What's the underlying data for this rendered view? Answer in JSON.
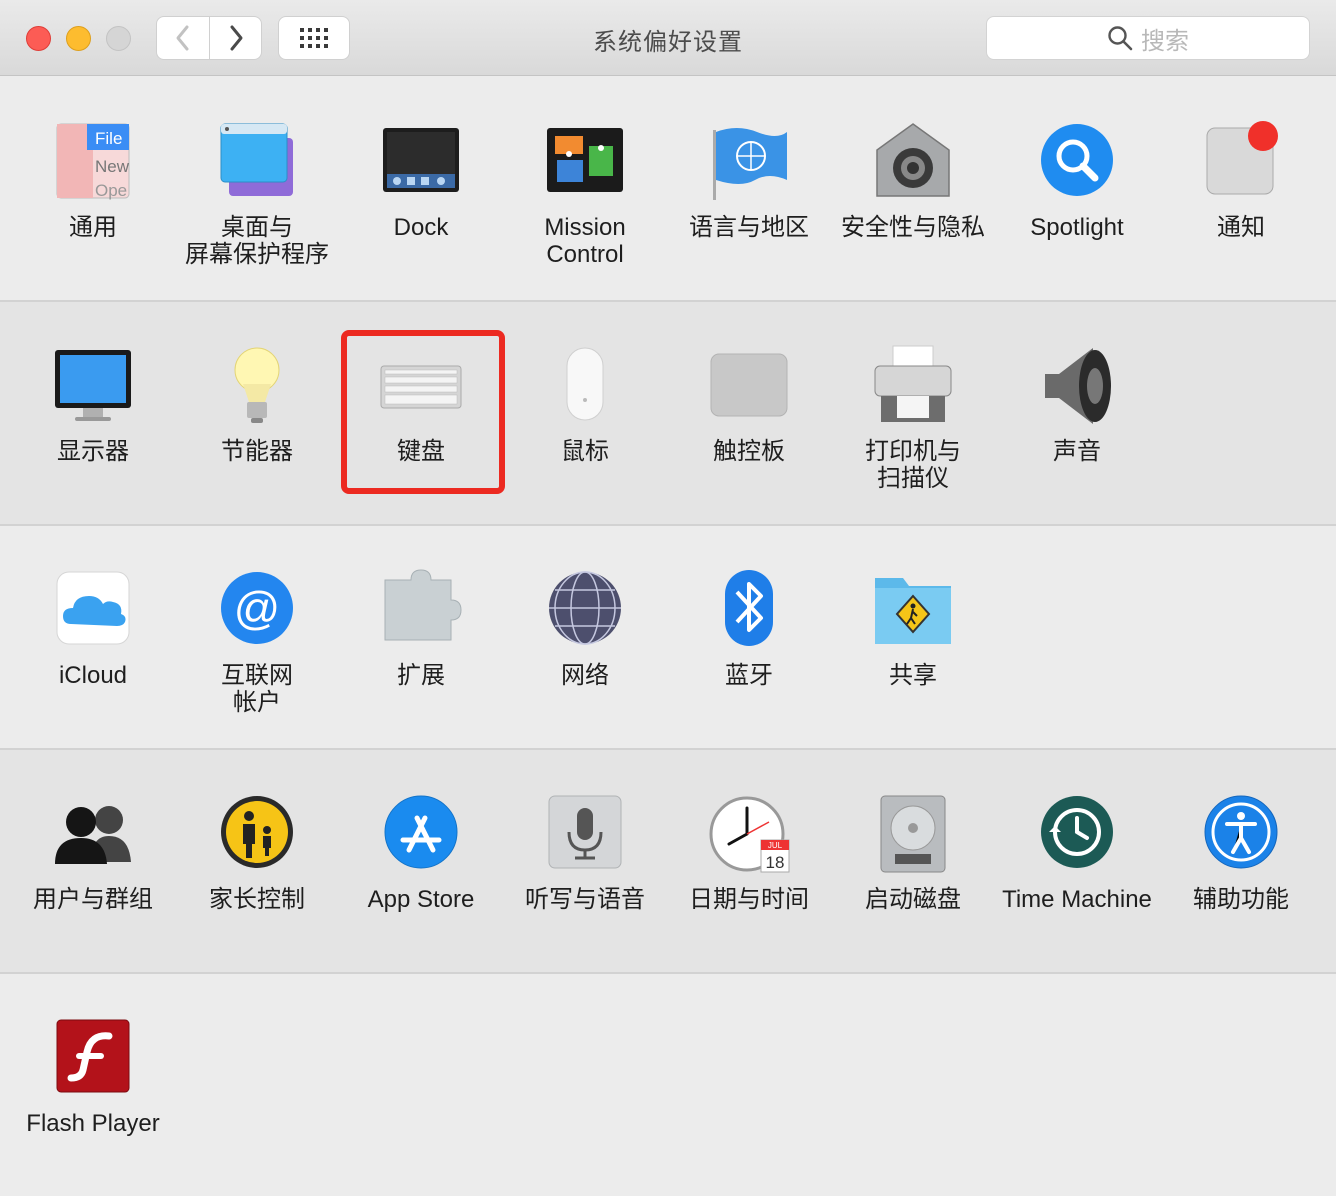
{
  "window": {
    "title": "系统偏好设置",
    "search_placeholder": "搜索"
  },
  "rows": [
    [
      {
        "icon": "general-icon",
        "label": "通用",
        "icon_text": [
          "File",
          "New",
          "Ope"
        ]
      },
      {
        "icon": "desktop-screensaver-icon",
        "label": "桌面与\n屏幕保护程序"
      },
      {
        "icon": "dock-icon",
        "label": "Dock"
      },
      {
        "icon": "mission-control-icon",
        "label": "Mission\nControl"
      },
      {
        "icon": "language-region-icon",
        "label": "语言与地区"
      },
      {
        "icon": "security-privacy-icon",
        "label": "安全性与隐私"
      },
      {
        "icon": "spotlight-icon",
        "label": "Spotlight"
      },
      {
        "icon": "notifications-icon",
        "label": "通知"
      }
    ],
    [
      {
        "icon": "displays-icon",
        "label": "显示器"
      },
      {
        "icon": "energy-saver-icon",
        "label": "节能器"
      },
      {
        "icon": "keyboard-icon",
        "label": "键盘"
      },
      {
        "icon": "mouse-icon",
        "label": "鼠标"
      },
      {
        "icon": "trackpad-icon",
        "label": "触控板"
      },
      {
        "icon": "printers-scanners-icon",
        "label": "打印机与\n扫描仪"
      },
      {
        "icon": "sound-icon",
        "label": "声音"
      }
    ],
    [
      {
        "icon": "icloud-icon",
        "label": "iCloud"
      },
      {
        "icon": "internet-accounts-icon",
        "label": "互联网\n帐户"
      },
      {
        "icon": "extensions-icon",
        "label": "扩展"
      },
      {
        "icon": "network-icon",
        "label": "网络"
      },
      {
        "icon": "bluetooth-icon",
        "label": "蓝牙"
      },
      {
        "icon": "sharing-icon",
        "label": "共享"
      }
    ],
    [
      {
        "icon": "users-groups-icon",
        "label": "用户与群组"
      },
      {
        "icon": "parental-controls-icon",
        "label": "家长控制"
      },
      {
        "icon": "app-store-icon",
        "label": "App Store"
      },
      {
        "icon": "dictation-speech-icon",
        "label": "听写与语音"
      },
      {
        "icon": "date-time-icon",
        "label": "日期与时间",
        "icon_text": [
          "JUL",
          "18"
        ]
      },
      {
        "icon": "startup-disk-icon",
        "label": "启动磁盘"
      },
      {
        "icon": "time-machine-icon",
        "label": "Time Machine"
      },
      {
        "icon": "accessibility-icon",
        "label": "辅助功能"
      }
    ],
    [
      {
        "icon": "flash-player-icon",
        "label": "Flash Player"
      }
    ]
  ],
  "highlighted_item": "键盘",
  "colors": {
    "highlight": "#ec2a21",
    "close": "#fc5c55",
    "minimize": "#fdbc2f",
    "maximize": "#d5d5d5"
  }
}
